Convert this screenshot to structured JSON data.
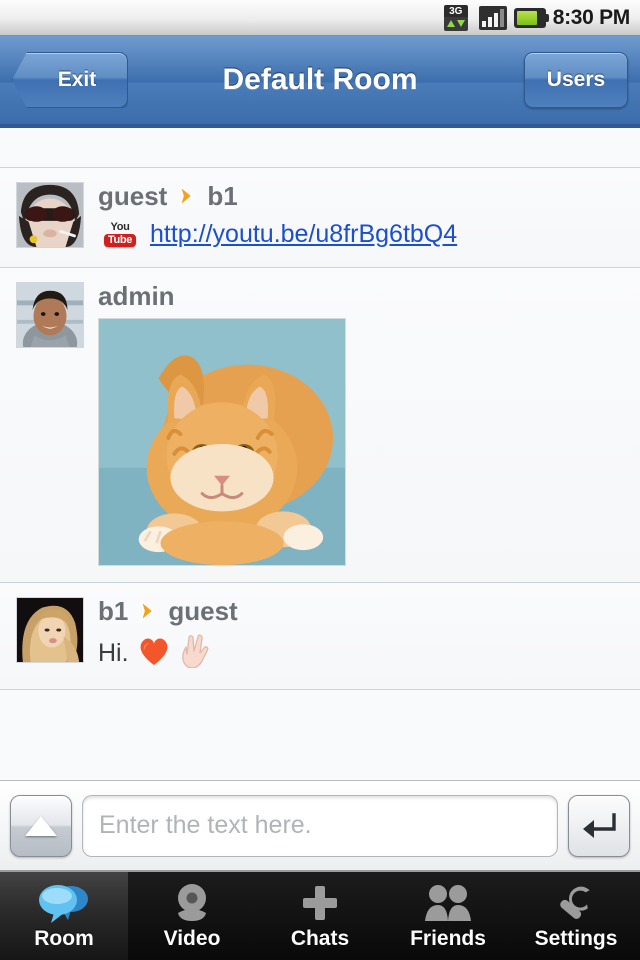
{
  "status_bar": {
    "network_label": "3G",
    "network_icon": "3g-data-icon",
    "signal_icon": "signal-bars-icon",
    "battery_icon": "battery-icon",
    "time": "8:30 PM"
  },
  "header": {
    "exit_label": "Exit",
    "title": "Default Room",
    "users_label": "Users",
    "accent_color": "#3d6fae"
  },
  "messages": [
    {
      "sender": "guest",
      "recipient": "b1",
      "arrow_icon": "arrow-right-icon",
      "avatar_icon": "avatar-guest",
      "link_badge": "youtube-icon",
      "youtube_top": "You",
      "youtube_bottom": "Tube",
      "link_text": "http://youtu.be/u8frBg6tbQ4",
      "link_color": "#1a4fd0"
    },
    {
      "sender": "admin",
      "recipient": "",
      "avatar_icon": "avatar-admin",
      "image_icon": "orange-tabby-kitten-photo"
    },
    {
      "sender": "b1",
      "recipient": "guest",
      "arrow_icon": "arrow-right-icon",
      "avatar_icon": "avatar-b1",
      "text": "Hi.",
      "emoji": [
        "❤",
        "✌"
      ]
    }
  ],
  "input_bar": {
    "expand_icon": "triangle-up-icon",
    "placeholder": "Enter the text here.",
    "value": "",
    "send_icon": "return-arrow-icon"
  },
  "tabs": [
    {
      "label": "Room",
      "icon": "chat-bubbles-icon",
      "active": true
    },
    {
      "label": "Video",
      "icon": "webcam-icon",
      "active": false
    },
    {
      "label": "Chats",
      "icon": "plus-icon",
      "active": false
    },
    {
      "label": "Friends",
      "icon": "people-icon",
      "active": false
    },
    {
      "label": "Settings",
      "icon": "wrench-icon",
      "active": false
    }
  ]
}
